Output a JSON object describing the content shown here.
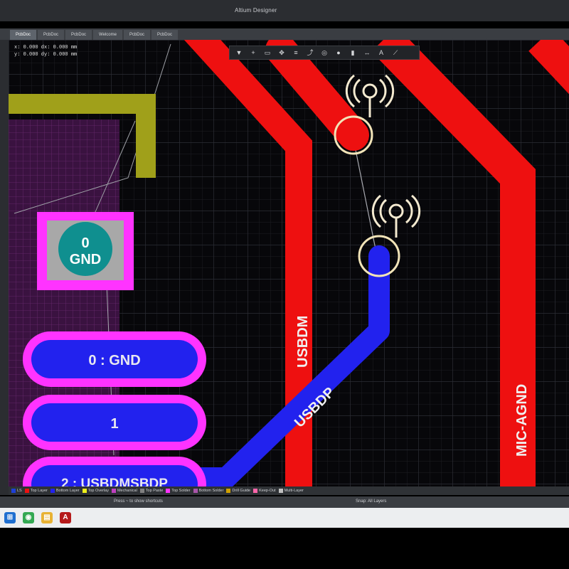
{
  "window": {
    "title": "Altium Designer"
  },
  "doc_tabs": [
    {
      "label": "PcbDoc"
    },
    {
      "label": "PcbDoc"
    },
    {
      "label": "PcbDoc"
    },
    {
      "label": "Welcome"
    },
    {
      "label": "PcbDoc"
    },
    {
      "label": "PcbDoc"
    }
  ],
  "coords": {
    "line1": "x: 0.000   dx: 0.000 mm",
    "line2": "y: 0.000   dy: 0.000 mm"
  },
  "pcb": {
    "pad_square": {
      "line1": "0",
      "line2": "GND"
    },
    "pad_0": "0 : GND",
    "pad_1": "1",
    "pad_2": "2 : USBDMSBDP",
    "net_usbdm": "USBDM",
    "net_usbdp": "USBDP",
    "net_mic_agnd": "MIC-AGND"
  },
  "colors": {
    "top_layer": "#ee1010",
    "bottom_layer": "#2222ee",
    "silkscreen": "#a0a01a",
    "solder_mask": "#ff33ff",
    "pad_teal": "#0f8f8f",
    "via_ring": "#f2e4b8",
    "grid": "#25262d"
  },
  "layers": [
    {
      "name": "LS",
      "color": "#1e3fd8"
    },
    {
      "name": "Top Layer",
      "color": "#ee1010"
    },
    {
      "name": "Bottom Layer",
      "color": "#2222ee"
    },
    {
      "name": "Top Overlay",
      "color": "#f0f01a"
    },
    {
      "name": "Mechanical",
      "color": "#c040c0"
    },
    {
      "name": "Top Paste",
      "color": "#808080"
    },
    {
      "name": "Top Solder",
      "color": "#ff33ff"
    },
    {
      "name": "Bottom Solder",
      "color": "#aa55aa"
    },
    {
      "name": "Drill Guide",
      "color": "#d0a000"
    },
    {
      "name": "Keep-Out",
      "color": "#ff66aa"
    },
    {
      "name": "Multi-Layer",
      "color": "#c0c0c0"
    }
  ],
  "status": {
    "left": "Press ~ to show shortcuts",
    "right": "Snap: All Layers"
  },
  "taskbar": [
    {
      "name": "windows-start-icon",
      "glyph": "",
      "color": "#1f6fd0"
    },
    {
      "name": "chrome-icon",
      "glyph": "",
      "color": "#34a853"
    },
    {
      "name": "explorer-icon",
      "glyph": "",
      "color": "#e8b234"
    },
    {
      "name": "altium-icon",
      "glyph": "A",
      "color": "#b51a1a"
    }
  ]
}
